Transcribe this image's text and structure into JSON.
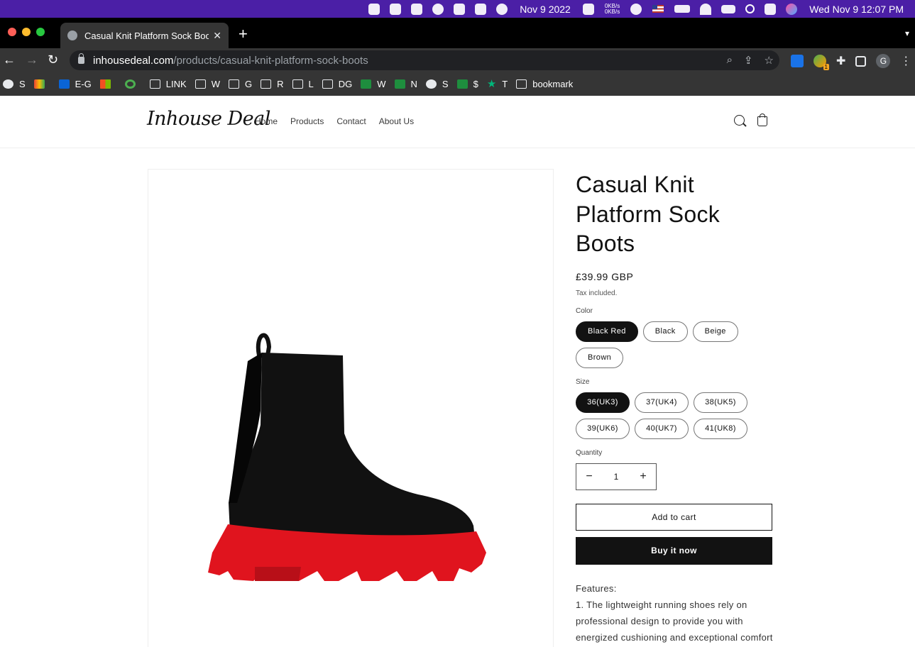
{
  "menubar": {
    "date_short": "Nov 9 2022",
    "net_up": "0KB/s",
    "net_down": "0KB/s",
    "clock": "Wed Nov 9  12:07 PM",
    "accent": "#4b1fa6"
  },
  "browser": {
    "tab_title": "Casual Knit Platform Sock Boots",
    "url_host": "inhousedeal.com",
    "url_path": "/products/casual-knit-platform-sock-boots",
    "profile_initial": "G",
    "extension_badge": "1",
    "bookmarks": [
      {
        "label": "S",
        "icon": "globe"
      },
      {
        "label": "",
        "icon": "gmail"
      },
      {
        "label": "E-G",
        "icon": "outlook"
      },
      {
        "label": "",
        "icon": "ms"
      },
      {
        "label": "",
        "icon": "g"
      },
      {
        "label": "LINK",
        "icon": "folder"
      },
      {
        "label": "W",
        "icon": "folder"
      },
      {
        "label": "G",
        "icon": "folder"
      },
      {
        "label": "R",
        "icon": "folder"
      },
      {
        "label": "L",
        "icon": "folder"
      },
      {
        "label": "DG",
        "icon": "folder"
      },
      {
        "label": "W",
        "icon": "sheet"
      },
      {
        "label": "N",
        "icon": "sheet"
      },
      {
        "label": "S",
        "icon": "globe"
      },
      {
        "label": "$",
        "icon": "sheet"
      },
      {
        "label": "T",
        "icon": "star"
      },
      {
        "label": "bookmark",
        "icon": "folder"
      }
    ]
  },
  "site": {
    "logo": "Inhouse Deal",
    "nav": [
      "Home",
      "Products",
      "Contact",
      "About Us"
    ]
  },
  "product": {
    "title": "Casual Knit Platform Sock Boots",
    "price": "£39.99 GBP",
    "tax_note": "Tax included.",
    "color_label": "Color",
    "colors": [
      "Black Red",
      "Black",
      "Beige",
      "Brown"
    ],
    "selected_color": "Black Red",
    "size_label": "Size",
    "sizes": [
      "36(UK3)",
      "37(UK4)",
      "38(UK5)",
      "39(UK6)",
      "40(UK7)",
      "41(UK8)"
    ],
    "selected_size": "36(UK3)",
    "quantity_label": "Quantity",
    "quantity": "1",
    "add_to_cart": "Add to cart",
    "buy_now": "Buy it now",
    "features_heading": "Features:",
    "features_text": "1. The lightweight running shoes rely on professional design to provide you with energized cushioning and exceptional comfort"
  },
  "colors": {
    "boot_body": "#111111",
    "boot_sole": "#e0141e",
    "button_dark": "#121212"
  }
}
